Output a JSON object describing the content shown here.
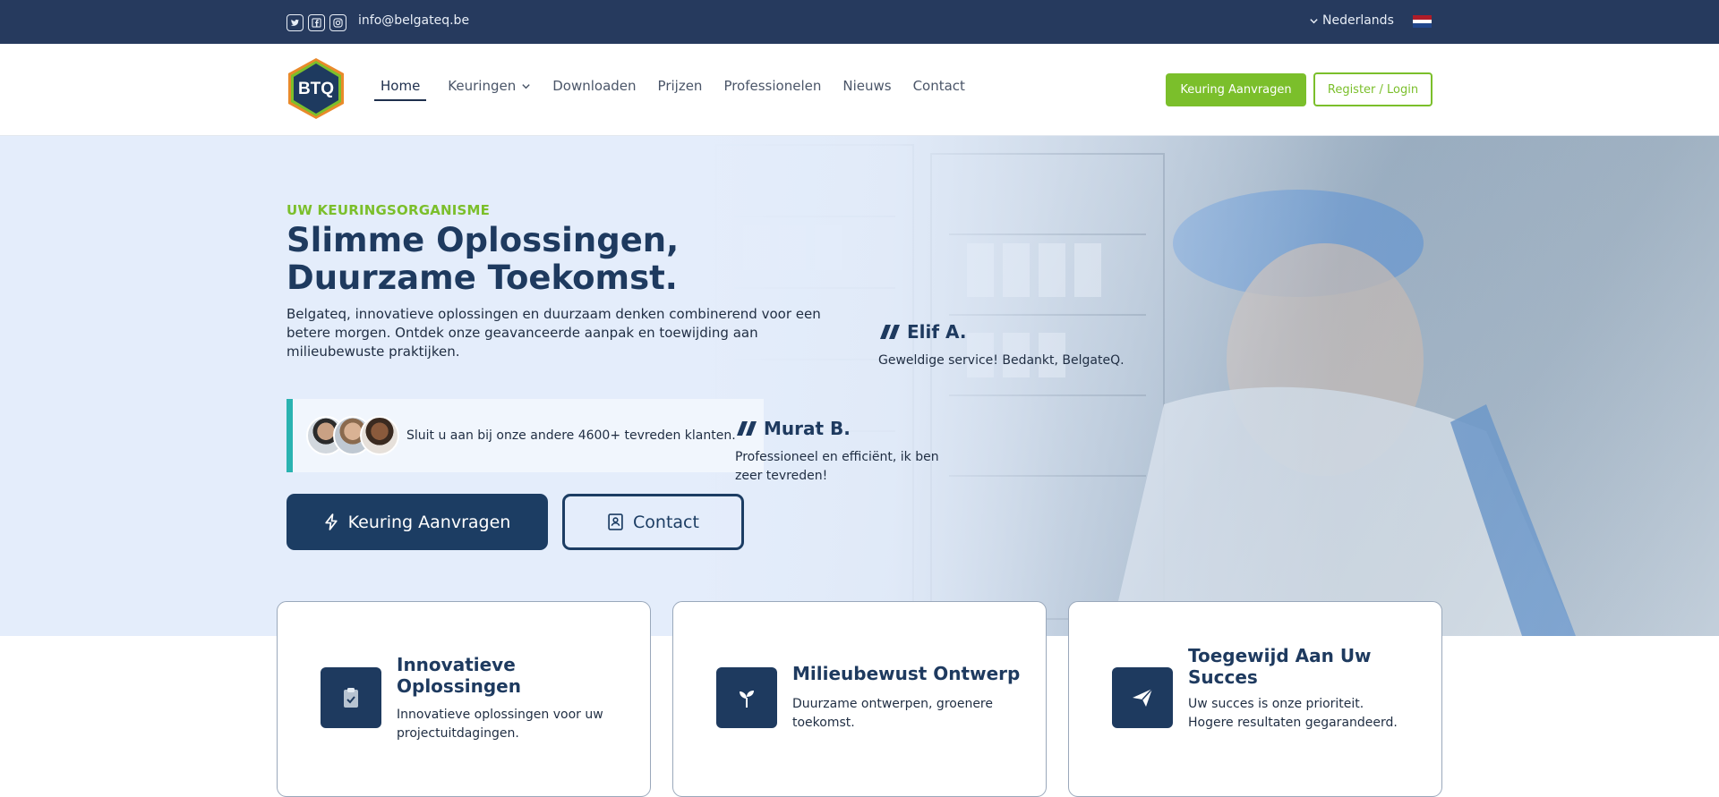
{
  "topbar": {
    "email": "info@belgateq.be",
    "language": "Nederlands",
    "social_icons": [
      "twitter-icon",
      "facebook-icon",
      "instagram-icon"
    ],
    "flag_colors": [
      "#ae1c28",
      "#ffffff",
      "#21468b"
    ]
  },
  "nav": {
    "logo_text": "BTQ",
    "items": [
      {
        "label": "Home",
        "active": true
      },
      {
        "label": "Keuringen",
        "dropdown": true
      },
      {
        "label": "Downloaden"
      },
      {
        "label": "Prijzen"
      },
      {
        "label": "Professionelen"
      },
      {
        "label": "Nieuws"
      },
      {
        "label": "Contact"
      }
    ],
    "cta_label": "Keuring Aanvragen",
    "login_label": "Register / Login"
  },
  "hero": {
    "eyebrow": "UW KEURINGSORGANISME",
    "title_line1": "Slimme Oplossingen,",
    "title_line2": "Duurzame Toekomst.",
    "description": "Belgateq, innovatieve oplossingen en duurzaam denken combinerend voor een betere morgen. Ontdek onze geavanceerde aanpak en toewijding aan milieubewuste praktijken.",
    "social_proof": "Sluit u aan bij onze andere 4600+ tevreden klanten.",
    "primary_button": "Keuring Aanvragen",
    "secondary_button": "Contact",
    "testimonials": [
      {
        "name": "Elif A.",
        "quote": "Geweldige service! Bedankt, BelgateQ."
      },
      {
        "name": "Murat B.",
        "quote": "Professioneel en efficiënt, ik ben zeer tevreden!"
      }
    ]
  },
  "features": [
    {
      "title": "Innovatieve Oplossingen",
      "description": "Innovatieve oplossingen voor uw projectuitdagingen.",
      "icon": "clipboard-check-icon"
    },
    {
      "title": "Milieubewust Ontwerp",
      "description": "Duurzame ontwerpen, groenere toekomst.",
      "icon": "sprout-icon"
    },
    {
      "title": "Toegewijd Aan Uw Succes",
      "description": "Uw succes is onze prioriteit. Hogere resultaten gegarandeerd.",
      "icon": "paper-plane-icon"
    }
  ],
  "colors": {
    "brand_navy": "#1e3a5f",
    "accent_green": "#7bbf2b",
    "teal": "#2ab3b1",
    "topbar": "#263a5e"
  }
}
